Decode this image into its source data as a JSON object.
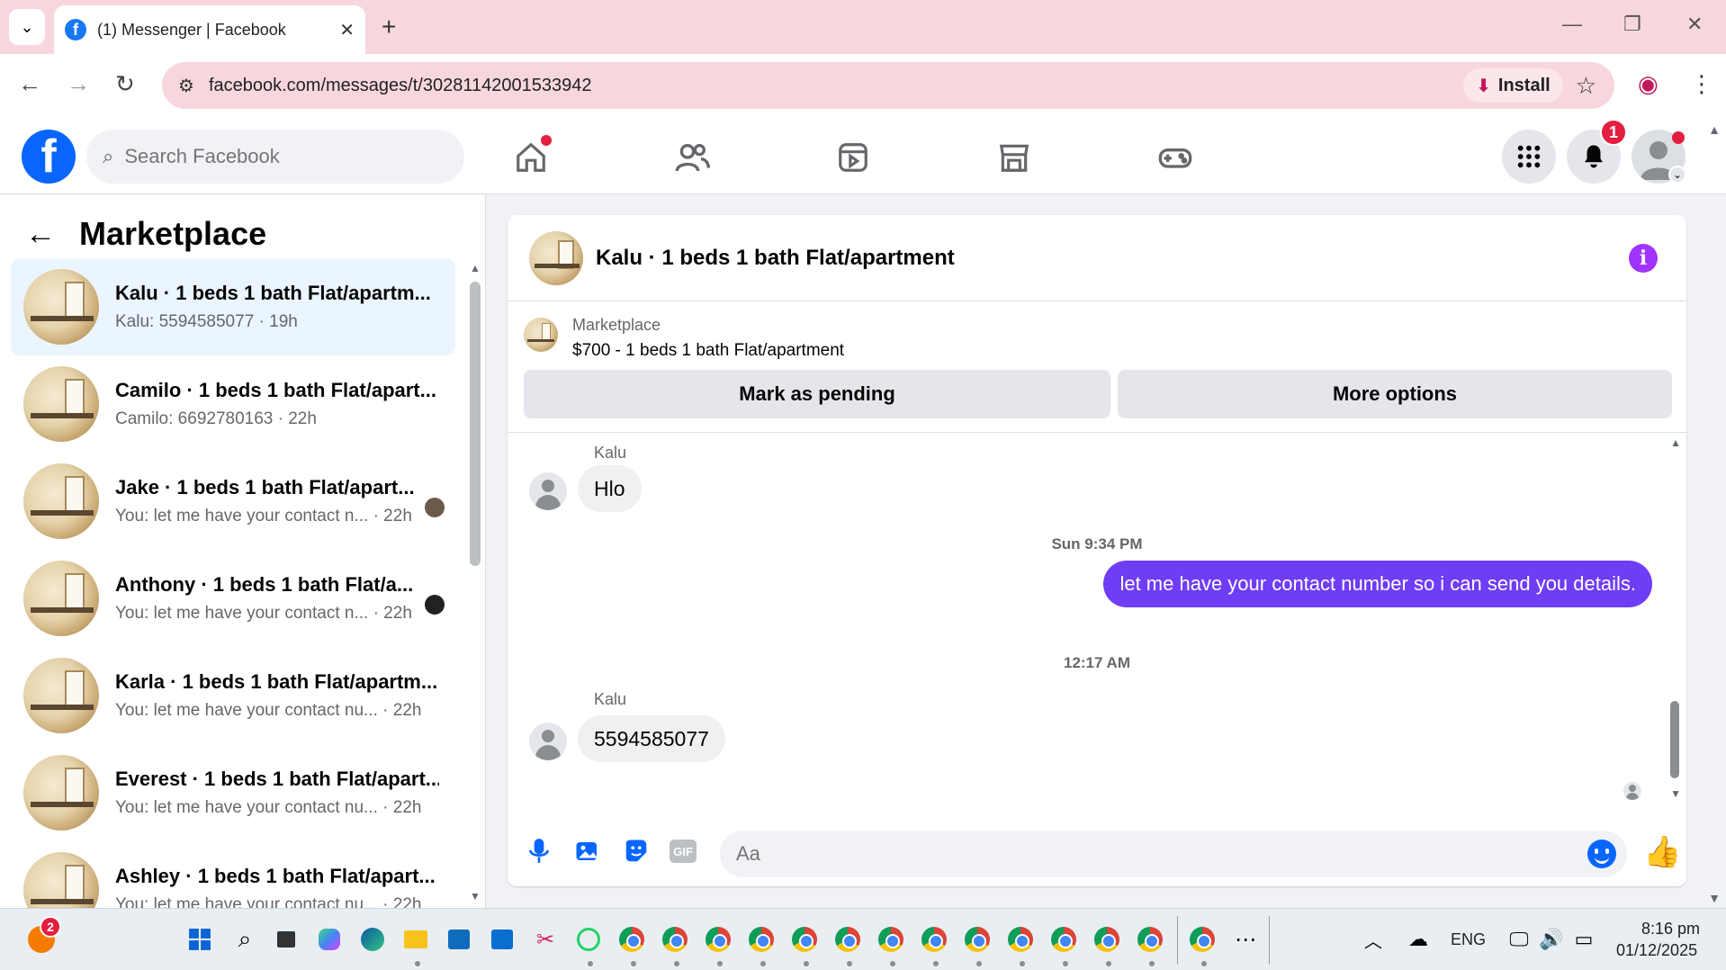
{
  "browser": {
    "tab_title": "(1) Messenger | Facebook",
    "url": "facebook.com/messages/t/30281142001533942",
    "install_label": "Install"
  },
  "header": {
    "search_placeholder": "Search Facebook",
    "notification_count": "1"
  },
  "sidebar": {
    "title": "Marketplace",
    "conversations": [
      {
        "name": "Kalu · 1 beds 1 bath Flat/apartm...",
        "snippet": "Kalu: 5594585077 · 19h",
        "active": true
      },
      {
        "name": "Camilo · 1 beds 1 bath Flat/apart...",
        "snippet": "Camilo: 6692780163 · 22h"
      },
      {
        "name": "Jake · 1 beds 1 bath Flat/apart...",
        "snippet": "You: let me have your contact n... · 22h"
      },
      {
        "name": "Anthony · 1 beds 1 bath Flat/a...",
        "snippet": "You: let me have your contact n... · 22h"
      },
      {
        "name": "Karla · 1 beds 1 bath Flat/apartm...",
        "snippet": "You: let me have your contact nu...  · 22h"
      },
      {
        "name": "Everest · 1 beds 1 bath Flat/apart...",
        "snippet": "You: let me have your contact nu...  · 22h"
      },
      {
        "name": "Ashley · 1 beds 1 bath Flat/apart...",
        "snippet": "You: let me have your contact nu...  · 22h"
      }
    ]
  },
  "chat": {
    "title": "Kalu · 1 beds 1 bath Flat/apartment",
    "marketplace_label": "Marketplace",
    "listing": "$700 - 1 beds 1 bath Flat/apartment",
    "mark_pending_label": "Mark as pending",
    "more_options_label": "More options",
    "messages": [
      {
        "sender": "Kalu",
        "text": "Hlo"
      },
      {
        "timestamp": "Sun 9:34 PM"
      },
      {
        "text": "let me have your contact number so i can send you details."
      },
      {
        "timestamp": "12:17 AM"
      },
      {
        "sender": "Kalu",
        "text": "5594585077"
      }
    ],
    "input_placeholder": "Aa"
  },
  "taskbar": {
    "notif_badge": "2",
    "language": "ENG",
    "time": "8:16 pm",
    "date": "01/12/2025"
  },
  "colors": {
    "facebook_blue": "#0866ff",
    "outgoing_bubble": "#6f3df6",
    "active_conversation": "#ebf5ff",
    "browser_accent": "#f7d7dd"
  }
}
